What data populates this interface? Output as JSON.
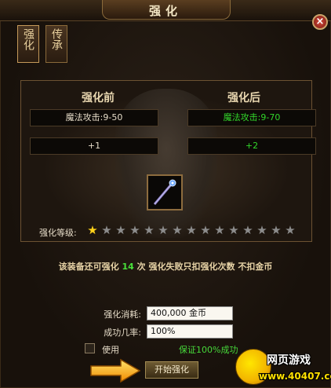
{
  "window": {
    "title": "强化",
    "close_label": "×"
  },
  "tabs": [
    {
      "label": "强化",
      "active": true
    },
    {
      "label": "传承",
      "active": false
    }
  ],
  "before": {
    "heading": "强化前",
    "attack": "魔法攻击:9-50",
    "level": "+1"
  },
  "after": {
    "heading": "强化后",
    "attack": "魔法攻击:9-70",
    "level": "+2",
    "color": "#32d62a"
  },
  "item": {
    "icon": "magic-staff-icon"
  },
  "enhance_level": {
    "label": "强化等级:",
    "filled": 1,
    "total": 15
  },
  "notice": {
    "prefix": "该装备还可强化",
    "count": "14",
    "suffix": "次  强化失败只扣强化次数  不扣金币"
  },
  "form": {
    "cost_label": "强化消耗:",
    "cost_value": "400,000 金币",
    "rate_label": "成功几率:",
    "rate_value": "100%"
  },
  "options": {
    "use_label": "使用",
    "guarantee_label": "保证100%成功"
  },
  "start_button": {
    "label": "开始强化"
  },
  "watermark": {
    "brand": "网页游戏",
    "site": "www.40407.com"
  },
  "colors": {
    "accent_gold": "#c59a5a",
    "success_green": "#32d62a",
    "panel_dark": "#1b130c"
  }
}
